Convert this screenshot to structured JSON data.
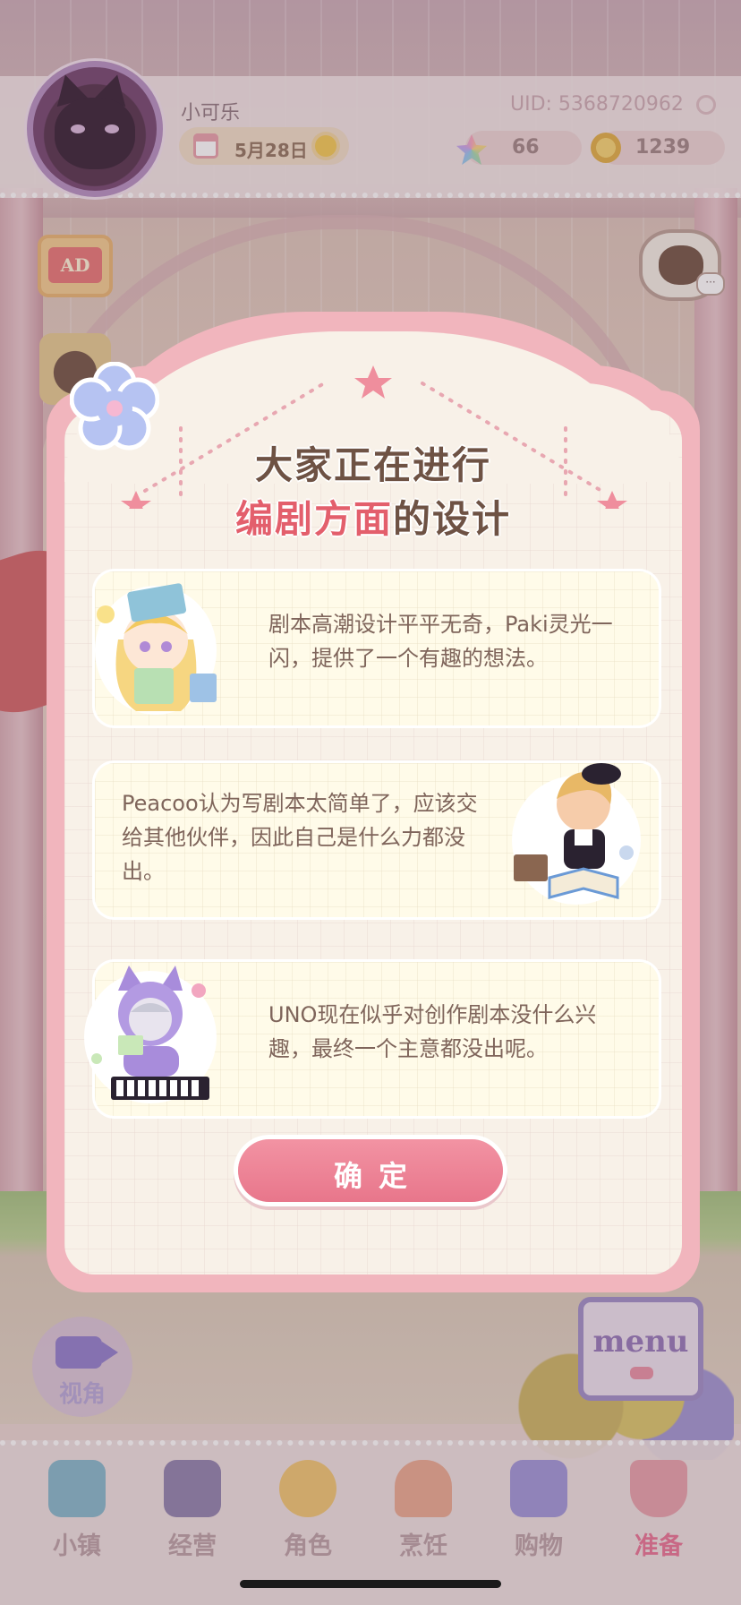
{
  "player": {
    "name": "小可乐",
    "date": "5月28日",
    "uid": "UID: 5368720962",
    "gems": "66",
    "coins": "1239"
  },
  "side_buttons": {
    "ad_label": "AD",
    "view_label": "视角",
    "menu_label": "menu"
  },
  "dialog": {
    "title_line1": "大家正在进行",
    "title_highlight": "编剧方面",
    "title_rest": "的设计",
    "cards": [
      {
        "text": "剧本高潮设计平平无奇，Paki灵光一闪，提供了一个有趣的想法。"
      },
      {
        "text": "Peacoo认为写剧本太简单了，应该交给其他伙伴，因此自己是什么力都没出。"
      },
      {
        "text": "UNO现在似乎对创作剧本没什么兴趣，最终一个主意都没出呢。"
      }
    ],
    "confirm_label": "确定"
  },
  "bottom_nav": [
    {
      "label": "小镇",
      "icon": "map-icon",
      "color": "#7fb3c8"
    },
    {
      "label": "经营",
      "icon": "bag-icon",
      "color": "#8a7aa8"
    },
    {
      "label": "角色",
      "icon": "character-icon",
      "color": "#f0c36a"
    },
    {
      "label": "烹饪",
      "icon": "sandwich-icon",
      "color": "#e9a48a"
    },
    {
      "label": "购物",
      "icon": "shopping-bag-icon",
      "color": "#9a8fd6"
    },
    {
      "label": "准备",
      "icon": "gift-basket-icon",
      "color": "#e79aa6",
      "active": true
    }
  ],
  "colors": {
    "accent_pink": "#e8768b",
    "title_brown": "#6e5244",
    "highlight_red": "#e35f6c",
    "dialog_frame": "#f1b5bd",
    "dialog_bg": "#f8f1e8"
  }
}
